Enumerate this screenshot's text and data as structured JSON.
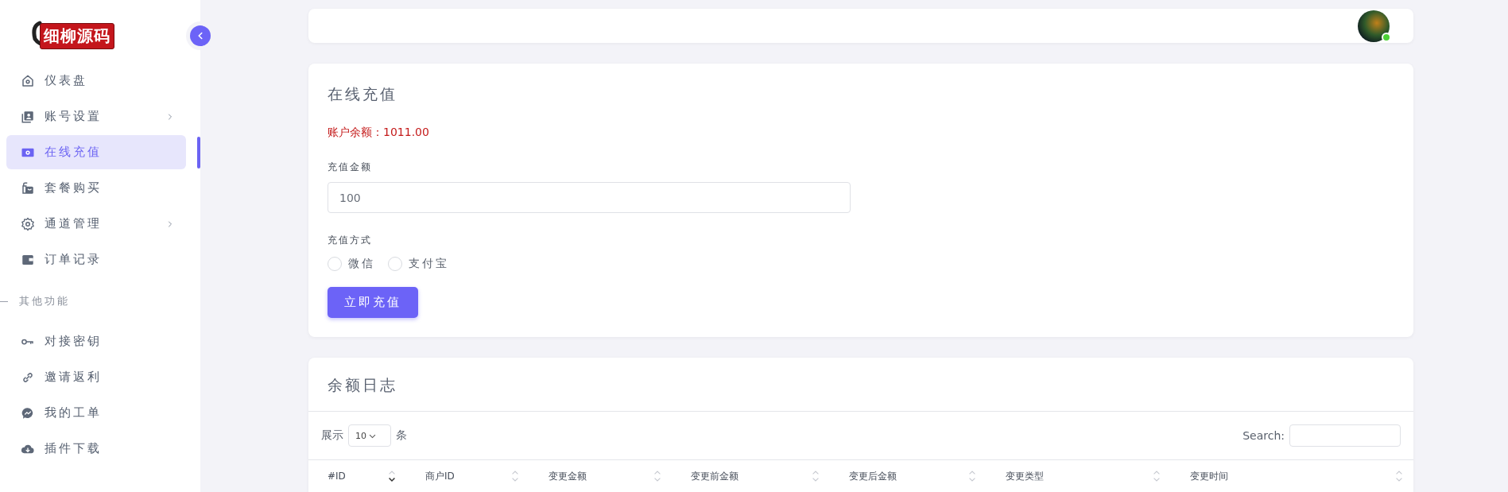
{
  "logo": {
    "text": "细柳源码"
  },
  "sidebar": {
    "items": [
      {
        "kind": "home",
        "label": "仪表盘",
        "expandable": false,
        "selected": false
      },
      {
        "kind": "account",
        "label": "账号设置",
        "expandable": true,
        "selected": false
      },
      {
        "kind": "money",
        "label": "在线充值",
        "expandable": false,
        "selected": true
      },
      {
        "kind": "bag",
        "label": "套餐购买",
        "expandable": false,
        "selected": false
      },
      {
        "kind": "gear",
        "label": "通道管理",
        "expandable": true,
        "selected": false
      },
      {
        "kind": "wallet",
        "label": "订单记录",
        "expandable": false,
        "selected": false
      }
    ],
    "section": "其他功能",
    "other_items": [
      {
        "kind": "key",
        "label": "对接密钥",
        "expandable": false,
        "selected": false
      },
      {
        "kind": "link",
        "label": "邀请返利",
        "expandable": false,
        "selected": false
      },
      {
        "kind": "chat",
        "label": "我的工单",
        "expandable": false,
        "selected": false
      },
      {
        "kind": "cloud",
        "label": "插件下载",
        "expandable": false,
        "selected": false
      }
    ]
  },
  "topbar": {
    "online": true
  },
  "recharge": {
    "title": "在线充值",
    "balance": "账户余额：1011.00",
    "amount_label": "充值金额",
    "amount_value": "100",
    "method_label": "充值方式",
    "methods": [
      {
        "label": "微信",
        "selected": false
      },
      {
        "label": "支付宝",
        "selected": false
      }
    ],
    "submit": "立即充值"
  },
  "log": {
    "title": "余额日志",
    "show_label": "展示",
    "page_size": "10",
    "unit": "条",
    "search_label": "Search:",
    "columns": [
      {
        "label": "#ID",
        "kind": "sorted_desc"
      },
      {
        "label": "商户ID",
        "kind": "sortable"
      },
      {
        "label": "变更金额",
        "kind": "sortable"
      },
      {
        "label": "变更前金额",
        "kind": "sortable"
      },
      {
        "label": "变更后金额",
        "kind": "sortable"
      },
      {
        "label": "变更类型",
        "kind": "sortable"
      },
      {
        "label": "变更时间",
        "kind": "sortable"
      }
    ]
  }
}
